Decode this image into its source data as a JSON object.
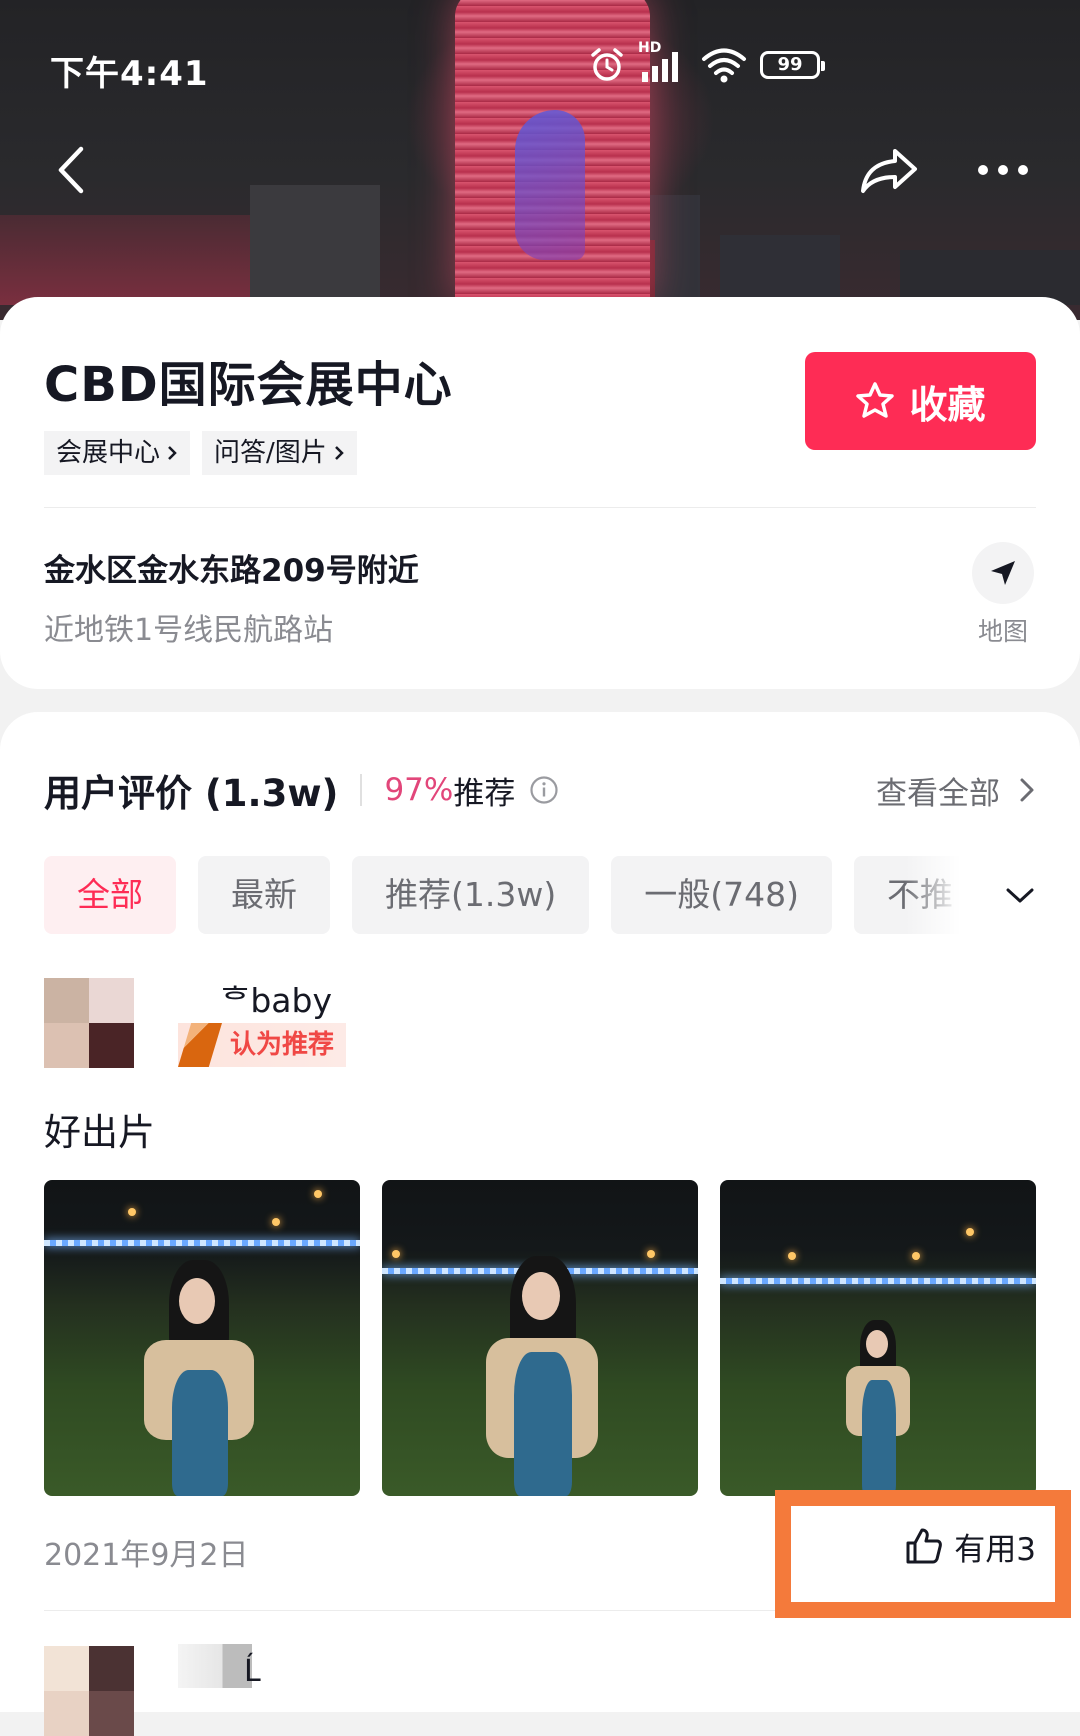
{
  "status_bar": {
    "time": "下午4:41",
    "network_label": "HD",
    "battery": "99"
  },
  "colors": {
    "accent": "#fe2c55",
    "accent_soft": "#feeff1",
    "recommend_pct": "#e2467a",
    "highlight_box": "#f47a3b"
  },
  "icons": {
    "back": "chevron-left-icon",
    "share": "share-arrow-icon",
    "more": "more-dots-icon",
    "favorite": "star-outline-icon",
    "map": "navigation-arrow-icon",
    "info": "info-circle-icon",
    "see_all": "chevron-right-icon",
    "expand": "chevron-down-icon",
    "useful": "thumbs-up-icon"
  },
  "place": {
    "name": "CBD国际会展中心",
    "tags": [
      {
        "label": "会展中心"
      },
      {
        "label": "问答/图片"
      }
    ],
    "favorite_label": "收藏",
    "address": "金水区金水东路209号附近",
    "subway": "近地铁1号线民航路站",
    "map_label": "地图"
  },
  "reviews": {
    "title": "用户评价 (1.3w)",
    "recommend_pct": "97%",
    "recommend_label": "推荐",
    "see_all": "查看全部",
    "filters": [
      {
        "label": "全部",
        "active": true
      },
      {
        "label": "最新",
        "active": false
      },
      {
        "label": "推荐(1.3w)",
        "active": false
      },
      {
        "label": "一般(748)",
        "active": false
      },
      {
        "label": "不推",
        "active": false
      }
    ],
    "items": [
      {
        "username": "ᄒbaby",
        "badge": "认为推荐",
        "text": "好出片",
        "photo_count": 3,
        "date": "2021年9月2日",
        "useful_label": "有用3"
      }
    ],
    "next_username_fragment": "Ĺ"
  }
}
